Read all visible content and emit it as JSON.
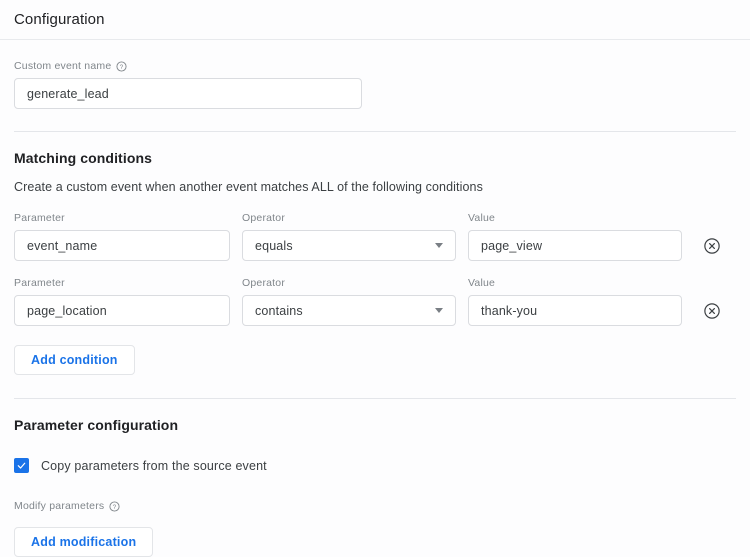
{
  "header": {
    "title": "Configuration"
  },
  "custom_event": {
    "label": "Custom event name",
    "help_icon": "help-circle-icon",
    "value": "generate_lead",
    "placeholder": ""
  },
  "matching_conditions": {
    "title": "Matching conditions",
    "description": "Create a custom event when another event matches ALL of the following conditions",
    "labels": {
      "parameter": "Parameter",
      "operator": "Operator",
      "value": "Value"
    },
    "rows": [
      {
        "parameter": "event_name",
        "operator": "equals",
        "value": "page_view",
        "remove_icon": "remove-circle-icon"
      },
      {
        "parameter": "page_location",
        "operator": "contains",
        "value": "thank-you",
        "remove_icon": "remove-circle-icon"
      }
    ],
    "add_condition_label": "Add condition"
  },
  "parameter_configuration": {
    "title": "Parameter configuration",
    "copy_parameters": {
      "label": "Copy parameters from the source event",
      "checked": true
    },
    "modify_parameters": {
      "label": "Modify parameters",
      "help_icon": "help-circle-icon"
    },
    "add_modification_label": "Add modification"
  },
  "colors": {
    "accent": "#1a73e8",
    "text_primary": "#202124",
    "text_secondary": "#3c4043",
    "text_muted": "#80868b",
    "border": "#dadce0",
    "divider": "#e8eaed",
    "background": "#fdfdfe"
  }
}
